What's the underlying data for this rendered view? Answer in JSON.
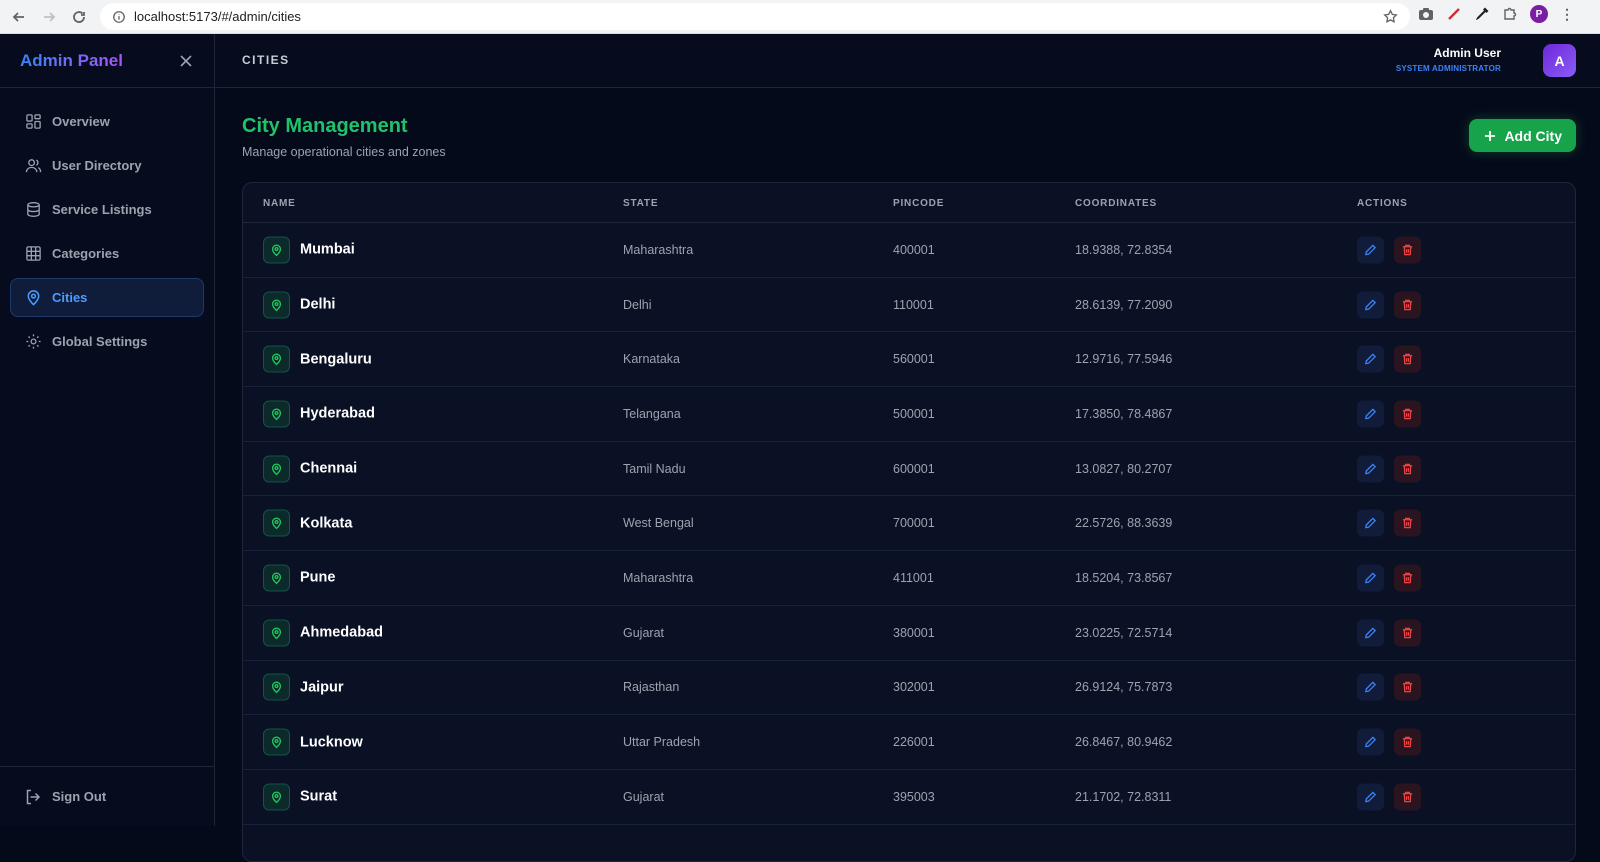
{
  "browser": {
    "url": "localhost:5173/#/admin/cities",
    "profile_initial": "P"
  },
  "sidebar": {
    "brand": "Admin Panel",
    "items": [
      {
        "label": "Overview",
        "icon": "dashboard-icon"
      },
      {
        "label": "User Directory",
        "icon": "users-icon"
      },
      {
        "label": "Service Listings",
        "icon": "database-icon"
      },
      {
        "label": "Categories",
        "icon": "grid-icon"
      },
      {
        "label": "Cities",
        "icon": "map-pin-icon",
        "active": true
      },
      {
        "label": "Global Settings",
        "icon": "gear-icon"
      }
    ],
    "sign_out": "Sign Out"
  },
  "topbar": {
    "title": "CITIES",
    "user_name": "Admin User",
    "user_role": "SYSTEM ADMINISTRATOR",
    "avatar_initial": "A"
  },
  "main": {
    "title": "City Management",
    "subtitle": "Manage operational cities and zones",
    "add_button": "Add City",
    "columns": [
      "NAME",
      "STATE",
      "PINCODE",
      "COORDINATES",
      "ACTIONS"
    ],
    "rows": [
      {
        "name": "Mumbai",
        "state": "Maharashtra",
        "pincode": "400001",
        "coords": "18.9388, 72.8354"
      },
      {
        "name": "Delhi",
        "state": "Delhi",
        "pincode": "110001",
        "coords": "28.6139, 77.2090"
      },
      {
        "name": "Bengaluru",
        "state": "Karnataka",
        "pincode": "560001",
        "coords": "12.9716, 77.5946"
      },
      {
        "name": "Hyderabad",
        "state": "Telangana",
        "pincode": "500001",
        "coords": "17.3850, 78.4867"
      },
      {
        "name": "Chennai",
        "state": "Tamil Nadu",
        "pincode": "600001",
        "coords": "13.0827, 80.2707"
      },
      {
        "name": "Kolkata",
        "state": "West Bengal",
        "pincode": "700001",
        "coords": "22.5726, 88.3639"
      },
      {
        "name": "Pune",
        "state": "Maharashtra",
        "pincode": "411001",
        "coords": "18.5204, 73.8567"
      },
      {
        "name": "Ahmedabad",
        "state": "Gujarat",
        "pincode": "380001",
        "coords": "23.0225, 72.5714"
      },
      {
        "name": "Jaipur",
        "state": "Rajasthan",
        "pincode": "302001",
        "coords": "26.9124, 75.7873"
      },
      {
        "name": "Lucknow",
        "state": "Uttar Pradesh",
        "pincode": "226001",
        "coords": "26.8467, 80.9462"
      },
      {
        "name": "Surat",
        "state": "Gujarat",
        "pincode": "395003",
        "coords": "21.1702, 72.8311"
      }
    ]
  },
  "colors": {
    "accent_green": "#1fc26b",
    "accent_blue": "#3b82f6",
    "danger": "#ef4444",
    "background": "#050a1a"
  }
}
